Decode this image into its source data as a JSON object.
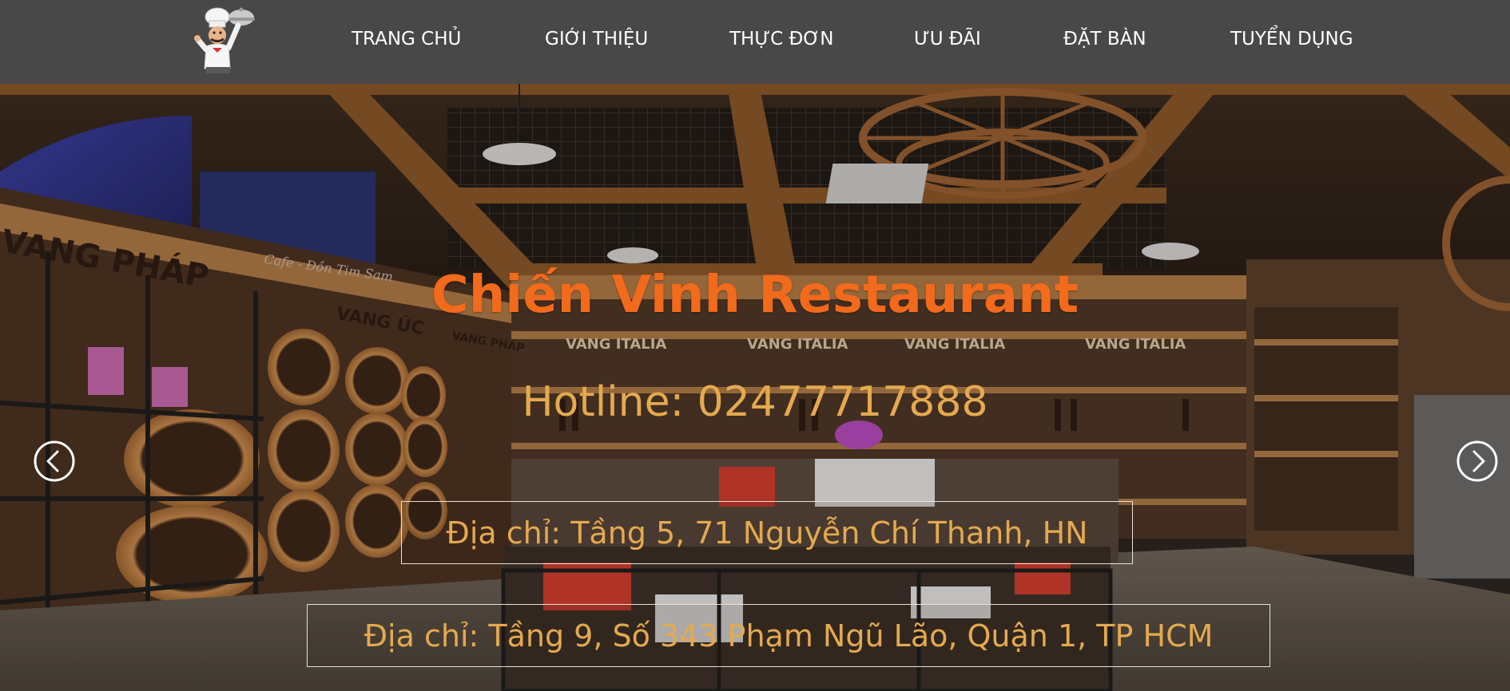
{
  "nav": {
    "logo_icon": "chef-mascot-icon",
    "links": [
      {
        "label": "TRANG CHỦ"
      },
      {
        "label": "GIỚI THIỆU"
      },
      {
        "label": "THỰC ĐƠN"
      },
      {
        "label": "ƯU ĐÃI"
      },
      {
        "label": "ĐẶT BÀN"
      },
      {
        "label": "TUYỂN DỤNG"
      }
    ]
  },
  "hero": {
    "title": "Chiến Vinh Restaurant",
    "hotline": "Hotline: 02477717888",
    "addresses": [
      "Địa chỉ: Tầng 5, 71 Nguyễn Chí Thanh, HN",
      "Địa chỉ: Tầng 9, Số 343 Phạm Ngũ Lão, Quận 1, TP HCM"
    ],
    "background_signs": {
      "left_big": "VANG PHÁP",
      "left_small": "VANG ÚC",
      "left_small_2": "VANG PHÁP",
      "shelf": [
        "VANG ITALIA",
        "VANG ITALIA",
        "VANG ITALIA",
        "VANG ITALIA"
      ],
      "cafe": "Cafe - Đồn Tim Sam"
    },
    "prev_icon": "chevron-left-circle-icon",
    "next_icon": "chevron-right-circle-icon"
  },
  "colors": {
    "navbar": "#484848",
    "title": "#f26a1b",
    "text_gold": "#e5a94f",
    "wood": "#8a5628"
  }
}
